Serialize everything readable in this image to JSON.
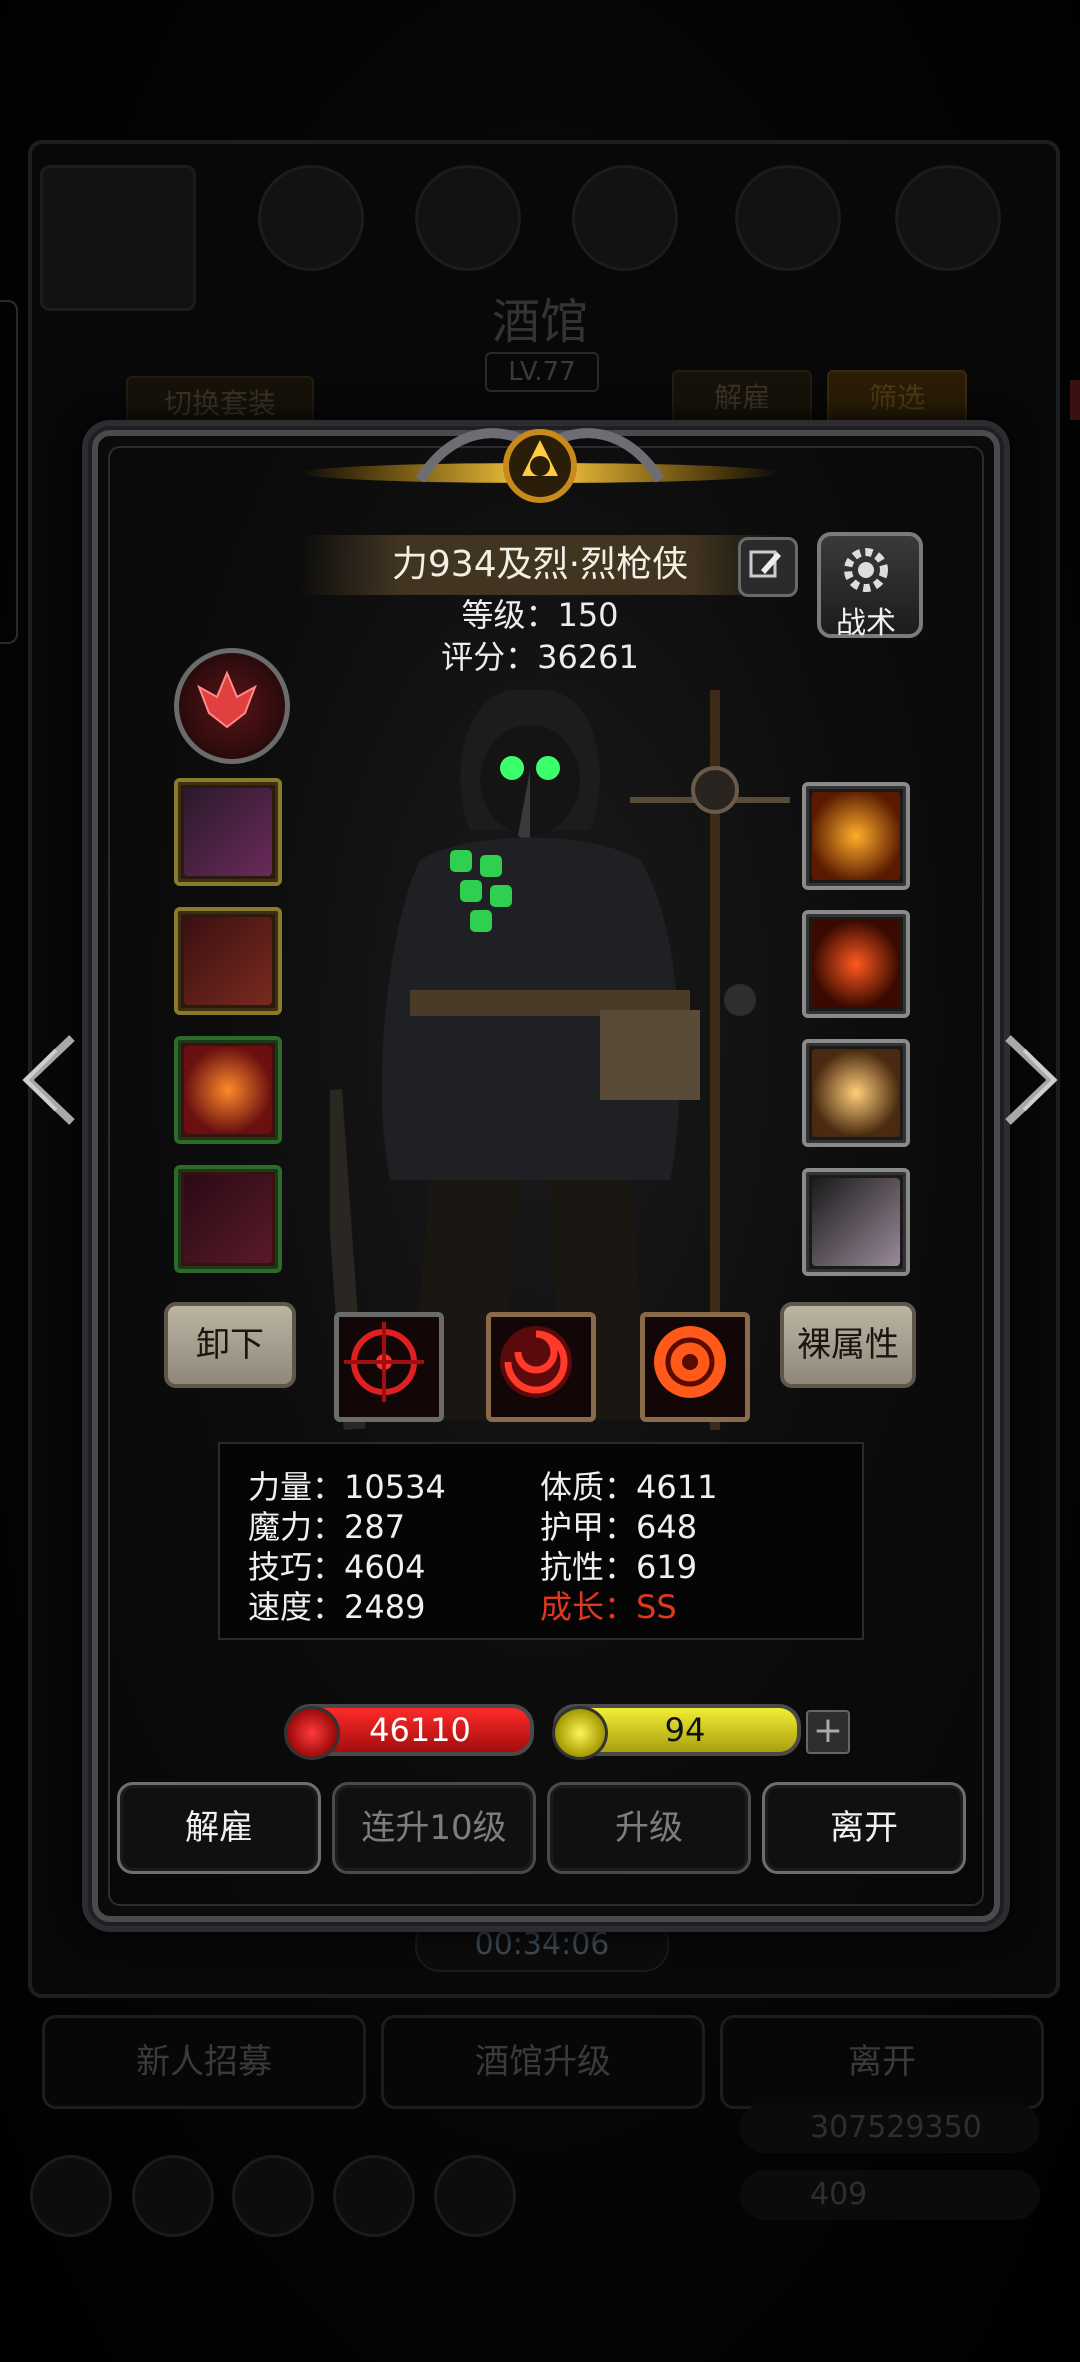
{
  "background": {
    "title": "酒馆",
    "level": "LV.77",
    "switch_outfit_label": "切换套装",
    "dismiss_filter_label": "解雇",
    "filter_label": "筛选",
    "timer": "00:34:06",
    "bottom_buttons": [
      "新人招募",
      "酒馆升级",
      "离开"
    ],
    "gold": "307529350",
    "gems": "409"
  },
  "hero": {
    "name": "力934及烈·烈枪侠",
    "level_text": "等级：150",
    "score_text": "评分：36261",
    "tactics_label": "战术",
    "unequip_label": "卸下",
    "naked_attr_label": "裸属性"
  },
  "stats": {
    "strength": "力量：10534",
    "magic": "魔力：287",
    "skill": "技巧：4604",
    "speed": "速度：2489",
    "constitution": "体质：4611",
    "armor": "护甲：648",
    "resistance": "抗性：619",
    "growth": "成长：SS",
    "growth_color": "#e0381e"
  },
  "bars": {
    "hp": "46110",
    "energy": "94",
    "energy_fill": 1.0,
    "plus_label": "+"
  },
  "actions": {
    "dismiss": "解雇",
    "level_up_10": "连升10级",
    "level_up": "升级",
    "leave": "离开"
  }
}
